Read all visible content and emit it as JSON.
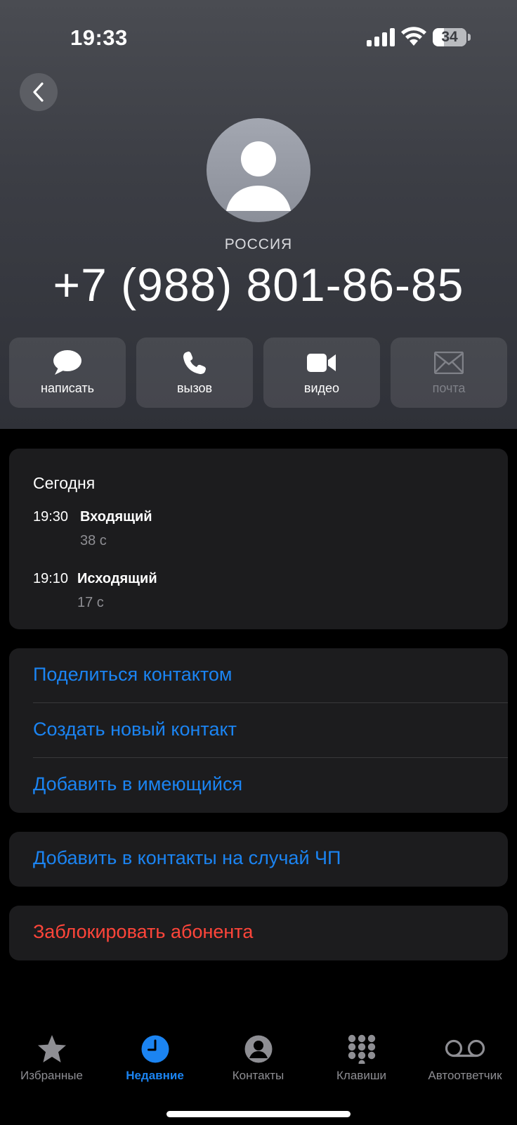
{
  "status": {
    "time": "19:33",
    "battery": "34"
  },
  "contact": {
    "country": "РОССИЯ",
    "phone": "+7 (988) 801-86-85"
  },
  "actions": [
    {
      "label": "написать",
      "icon": "message-bubble-icon",
      "enabled": true
    },
    {
      "label": "вызов",
      "icon": "phone-icon",
      "enabled": true
    },
    {
      "label": "видео",
      "icon": "video-camera-icon",
      "enabled": true
    },
    {
      "label": "почта",
      "icon": "mail-envelope-icon",
      "enabled": false
    }
  ],
  "history": {
    "title": "Сегодня",
    "entries": [
      {
        "time": "19:30",
        "type": "Входящий",
        "duration": "38 с"
      },
      {
        "time": "19:10",
        "type": "Исходящий",
        "duration": "17 с"
      }
    ]
  },
  "options": {
    "share_contact": "Поделиться контактом",
    "create_contact": "Создать новый контакт",
    "add_existing": "Добавить в имеющийся",
    "add_emergency": "Добавить в контакты на случай ЧП",
    "block_caller": "Заблокировать абонента"
  },
  "tabbar": {
    "active": "recents",
    "tabs": [
      {
        "id": "favorites",
        "label": "Избранные",
        "icon": "star-icon"
      },
      {
        "id": "recents",
        "label": "Недавние",
        "icon": "clock-icon"
      },
      {
        "id": "contacts",
        "label": "Контакты",
        "icon": "person-circle-icon"
      },
      {
        "id": "keypad",
        "label": "Клавиши",
        "icon": "keypad-grid-icon"
      },
      {
        "id": "voicemail",
        "label": "Автоответчик",
        "icon": "voicemail-icon"
      }
    ]
  },
  "colors": {
    "accent": "#1b84f2",
    "danger": "#ff453a",
    "card": "#1c1c1e",
    "secondary_text": "#8e8e93"
  }
}
